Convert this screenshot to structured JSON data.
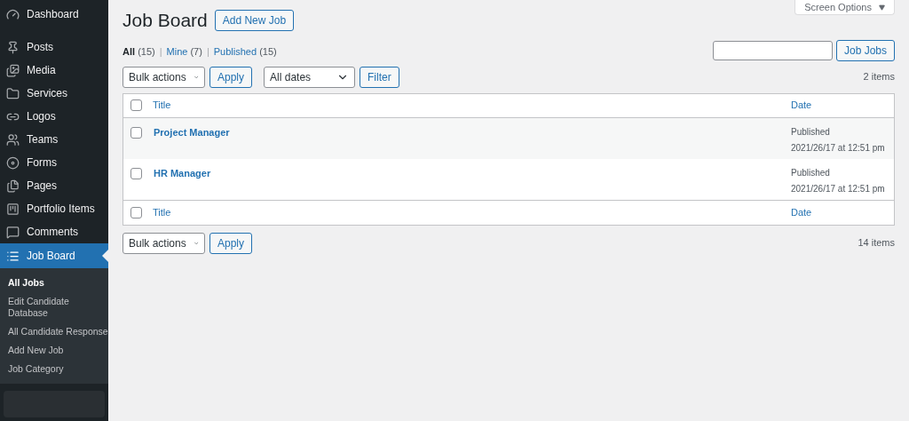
{
  "sidebar": {
    "items": [
      {
        "label": "Dashboard",
        "selected": false
      },
      {
        "label": "Posts",
        "selected": false
      },
      {
        "label": "Media",
        "selected": false
      },
      {
        "label": "Services",
        "selected": false
      },
      {
        "label": "Logos",
        "selected": false
      },
      {
        "label": "Teams",
        "selected": false
      },
      {
        "label": "Forms",
        "selected": false
      },
      {
        "label": "Pages",
        "selected": false
      },
      {
        "label": "Portfolio Items",
        "selected": false
      },
      {
        "label": "Comments",
        "selected": false
      },
      {
        "label": "Job Board",
        "selected": true,
        "children": [
          {
            "label": "All Jobs",
            "selected": true
          },
          {
            "label": "Edit Candidate Database",
            "selected": false
          },
          {
            "label": "All Candidate Response",
            "selected": false
          },
          {
            "label": "Add New Job",
            "selected": false
          },
          {
            "label": "Job Category",
            "selected": false
          }
        ]
      }
    ]
  },
  "screen_options": "Screen Options",
  "header": {
    "title": "Job Board",
    "add_button": "Add New Job"
  },
  "views": [
    {
      "label": "All",
      "count": "(15)",
      "selected": true
    },
    {
      "label": "Mine",
      "count": "(7)",
      "selected": false,
      "separator": "|"
    },
    {
      "label": "Published",
      "count": "(15)",
      "selected": false,
      "separator": "|"
    }
  ],
  "search": {
    "button": "Job Jobs"
  },
  "top_actions": {
    "bulk": "Bulk actions",
    "apply": "Apply",
    "dates": "All dates",
    "filter": "Filter",
    "count": "2 items"
  },
  "table": {
    "columns": [
      "Title",
      "Date"
    ],
    "header_checked": false,
    "footer_checked": false,
    "rows": [
      {
        "title": "Project Manager",
        "status": "Published",
        "date": "2021/26/17 at 12:51 pm",
        "checked": false
      },
      {
        "title": "HR Manager",
        "status": "Published",
        "date": "2021/26/17 at 12:51 pm",
        "checked": false
      }
    ],
    "footer_columns": [
      "Title",
      "Date"
    ]
  },
  "bottom_actions": {
    "bulk": "Bulk actions",
    "apply": "Apply",
    "count": "14 items"
  }
}
